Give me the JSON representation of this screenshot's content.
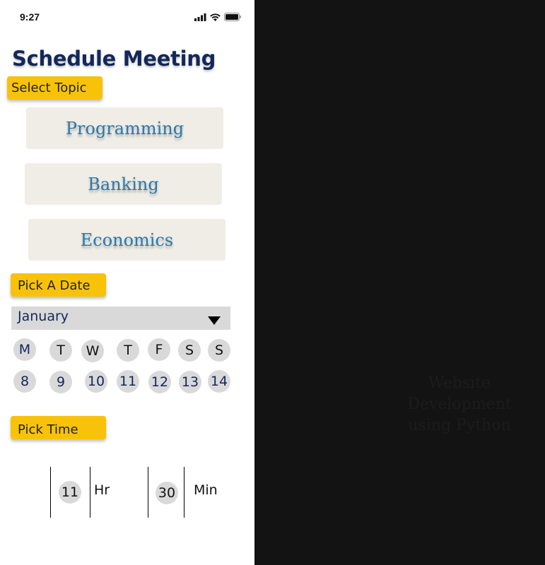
{
  "status_bar": {
    "time": "9:27",
    "icons": [
      "cellular-signal-icon",
      "wifi-icon",
      "battery-icon"
    ]
  },
  "page_title": "Schedule Meeting",
  "sections": {
    "topic_label": "Select Topic",
    "date_label": "Pick A Date",
    "time_label": "Pick Time"
  },
  "topics": [
    "Programming",
    "Banking",
    "Economics"
  ],
  "calendar": {
    "month": "January",
    "weekdays": [
      "M",
      "T",
      "W",
      "T",
      "F",
      "S",
      "S"
    ],
    "days": [
      "8",
      "9",
      "10",
      "11",
      "12",
      "13",
      "14"
    ]
  },
  "time_picker": {
    "hour": "11",
    "hour_unit": "Hr",
    "minute": "30",
    "minute_unit": "Min"
  },
  "background_caption": [
    "Website Development",
    "using Python"
  ],
  "colors": {
    "accent_yellow": "#f9c20a",
    "title_navy": "#13285a",
    "topic_text_blue": "#2f78a8",
    "topic_button_bg": "#efede6",
    "circle_gray": "#d9d9d9",
    "page_background": "#131313"
  }
}
